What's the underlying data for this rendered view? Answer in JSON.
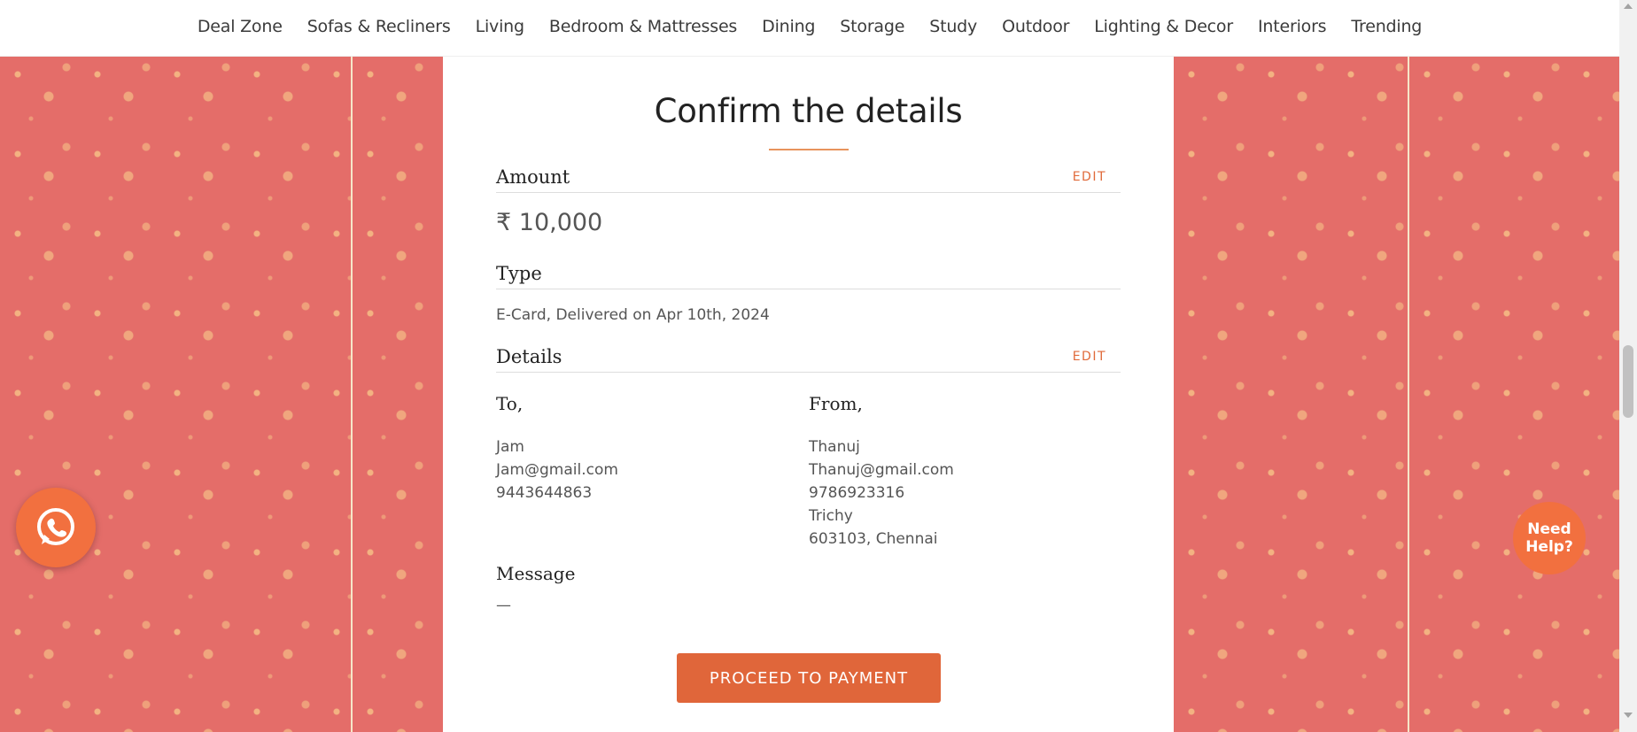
{
  "nav": {
    "items": [
      "Deal Zone",
      "Sofas & Recliners",
      "Living",
      "Bedroom & Mattresses",
      "Dining",
      "Storage",
      "Study",
      "Outdoor",
      "Lighting & Decor",
      "Interiors",
      "Trending"
    ]
  },
  "confirm": {
    "title": "Confirm the details",
    "amount_label": "Amount",
    "amount_edit": "EDIT",
    "amount_value": "₹ 10,000",
    "type_label": "Type",
    "type_value": "E-Card, Delivered on Apr 10th, 2024",
    "details_label": "Details",
    "details_edit": "EDIT",
    "to": {
      "title": "To,",
      "name": "Jam",
      "email": "Jam@gmail.com",
      "phone": "9443644863"
    },
    "from": {
      "title": "From,",
      "name": "Thanuj",
      "email": "Thanuj@gmail.com",
      "phone": "9786923316",
      "city": "Trichy",
      "pincode_state": "603103, Chennai"
    },
    "message_label": "Message",
    "message_value": "—",
    "proceed_label": "PROCEED TO PAYMENT"
  },
  "floating": {
    "whatsapp_icon": "whatsapp-icon",
    "need_help": "Need Help?"
  },
  "colors": {
    "accent": "#e0663a",
    "pattern_bg": "#e46d69",
    "pattern_motif": "#ffec96"
  }
}
